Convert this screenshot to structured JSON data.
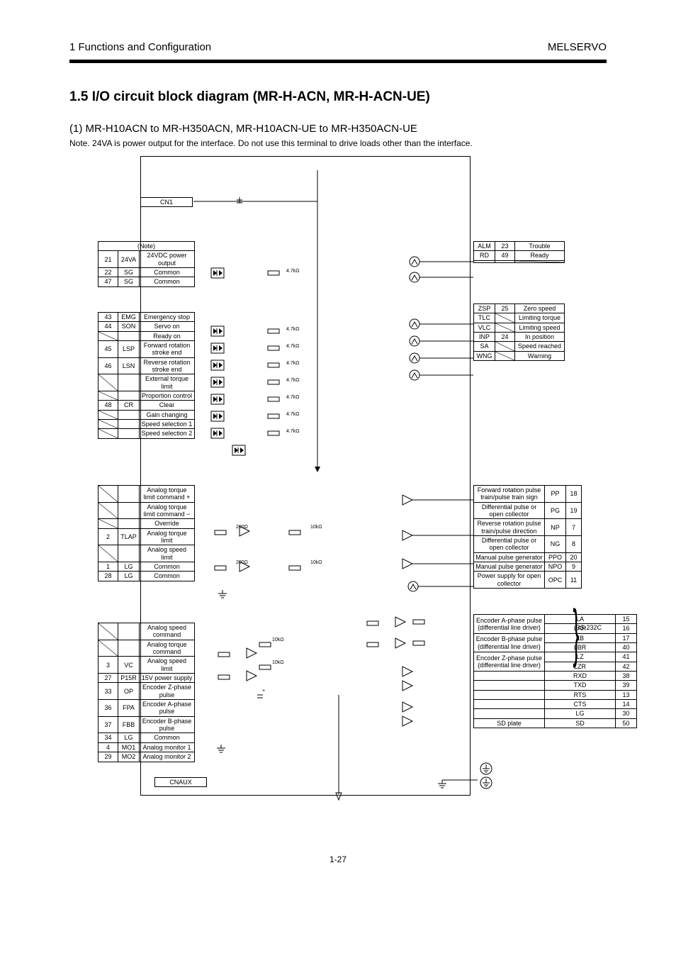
{
  "header": {
    "left": "1 Functions and Configuration",
    "right": "MELSERVO"
  },
  "section_title": "1.5  I/O circuit block diagram (MR-H-ACN, MR-H-ACN-UE)",
  "subtitle": "(1) MR-H10ACN to MR-H350ACN, MR-H10ACN-UE to MR-H350ACN-UE",
  "note": "Note. 24VA is power output for the interface. Do not use this terminal to drive loads other than the interface.",
  "connectors": {
    "cn1": "CN1",
    "cnaux": "CNAUX"
  },
  "left_tables": {
    "t1_header": "(Note)",
    "t1": [
      [
        "21",
        "24VA",
        "24VDC power output"
      ],
      [
        "22",
        "SG",
        "Common"
      ],
      [
        "47",
        "SG",
        "Common"
      ]
    ],
    "t2": [
      [
        "43",
        "EMG",
        "Emergency stop"
      ],
      [
        "44",
        "SON",
        "Servo on"
      ],
      [
        "",
        "",
        "Ready on"
      ],
      [
        "45",
        "LSP",
        "Forward rotation stroke end"
      ],
      [
        "46",
        "LSN",
        "Reverse rotation stroke end"
      ],
      [
        "",
        "",
        "External torque limit"
      ],
      [
        "",
        "",
        "Proportion control"
      ],
      [
        "48",
        "CR",
        "Clear"
      ],
      [
        "",
        "",
        "Gain changing"
      ],
      [
        "",
        "",
        "Speed selection 1"
      ],
      [
        "",
        "",
        "Speed selection 2"
      ]
    ],
    "t3": [
      [
        "",
        "",
        "Analog torque limit command +"
      ],
      [
        "",
        "",
        "Analog torque limit command −"
      ],
      [
        "",
        "",
        "Override"
      ],
      [
        "2",
        "TLAP",
        "Analog torque limit"
      ],
      [
        "",
        "",
        "Analog speed limit"
      ],
      [
        "1",
        "LG",
        "Common"
      ],
      [
        "28",
        "LG",
        "Common"
      ]
    ],
    "t4": [
      [
        "",
        "",
        "Analog speed command"
      ],
      [
        "",
        "",
        "Analog torque command"
      ],
      [
        "3",
        "VC",
        "Analog speed limit"
      ],
      [
        "27",
        "P15R",
        "15V power supply"
      ],
      [
        "33",
        "OP",
        "Encoder Z-phase pulse"
      ],
      [
        "36",
        "FPA",
        "Encoder A-phase pulse"
      ],
      [
        "37",
        "FBB",
        "Encoder B-phase pulse"
      ],
      [
        "34",
        "LG",
        "Common"
      ],
      [
        "4",
        "MO1",
        "Analog monitor 1"
      ],
      [
        "29",
        "MO2",
        "Analog monitor 2"
      ]
    ]
  },
  "right_tables": {
    "t1": [
      [
        "ALM",
        "23",
        "Trouble"
      ],
      [
        "RD",
        "49",
        "Ready"
      ]
    ],
    "t2": [
      [
        "ZSP",
        "25",
        "Zero speed"
      ],
      [
        "TLC",
        "",
        "Limiting torque"
      ],
      [
        "VLC",
        "",
        "Limiting speed"
      ],
      [
        "INP",
        "24",
        "In position"
      ],
      [
        "SA",
        "",
        "Speed reached"
      ],
      [
        "WNG",
        "",
        "Warning"
      ]
    ],
    "t3": [
      [
        "Forward rotation pulse train/pulse train sign",
        "PP",
        "18"
      ],
      [
        "Differential pulse or open collector",
        "PG",
        "19"
      ],
      [
        "Reverse rotation pulse train/pulse direction",
        "NP",
        "7"
      ],
      [
        "Differential pulse or open collector",
        "NG",
        "8"
      ],
      [
        "Manual pulse generator",
        "PPO",
        "20"
      ],
      [
        "Manual pulse generator",
        "NPO",
        "9"
      ],
      [
        "Power supply for open collector",
        "OPC",
        "11"
      ]
    ],
    "t4": [
      [
        "Encoder A-phase pulse (differential line driver)",
        "LA",
        "15"
      ],
      [
        "",
        "LAR",
        "16"
      ],
      [
        "Encoder B-phase pulse (differential line driver)",
        "LB",
        "17"
      ],
      [
        "",
        "LBR",
        "40"
      ],
      [
        "Encoder Z-phase pulse (differential line driver)",
        "LZ",
        "41"
      ],
      [
        "",
        "LZR",
        "42"
      ],
      [
        "",
        "RXD",
        "38"
      ],
      [
        "",
        "TXD",
        "39"
      ],
      [
        "",
        "RTS",
        "13"
      ],
      [
        "",
        "CTS",
        "14"
      ],
      [
        "",
        "LG",
        "30"
      ],
      [
        "SD plate",
        "SD",
        "50"
      ]
    ]
  },
  "rs232_label": "RS-232C",
  "components": {
    "resistor_values": [
      "4.7kΩ",
      "4.7kΩ",
      "4.7kΩ",
      "4.7kΩ",
      "4.7kΩ",
      "4.7kΩ",
      "4.7kΩ",
      "4.7kΩ"
    ],
    "current_limit": [
      "200Ω",
      "200Ω",
      "10kΩ",
      "10kΩ"
    ],
    "opamp_r": [
      "10kΩ",
      "10kΩ"
    ]
  },
  "page_number": "1-27"
}
